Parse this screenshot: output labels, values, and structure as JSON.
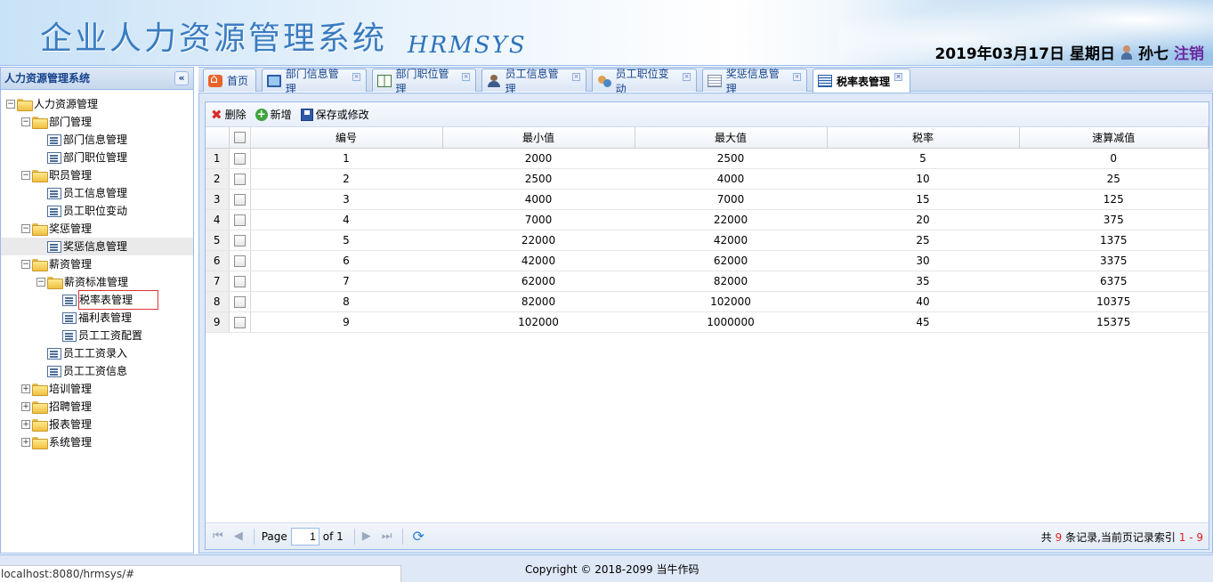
{
  "header": {
    "title": "企业人力资源管理系统",
    "subtitle": "HRMSYS",
    "date": "2019年03月17日 星期日",
    "user": "孙七",
    "logout": "注销"
  },
  "sidebar": {
    "title": "人力资源管理系统",
    "collapse": "«",
    "tree": [
      {
        "label": "人力资源管理",
        "type": "folder",
        "level": 0,
        "toggle": "⊟"
      },
      {
        "label": "部门管理",
        "type": "folder",
        "level": 1,
        "toggle": "⊟"
      },
      {
        "label": "部门信息管理",
        "type": "file",
        "level": 2
      },
      {
        "label": "部门职位管理",
        "type": "file",
        "level": 2
      },
      {
        "label": "职员管理",
        "type": "folder",
        "level": 1,
        "toggle": "⊟"
      },
      {
        "label": "员工信息管理",
        "type": "file",
        "level": 2
      },
      {
        "label": "员工职位变动",
        "type": "file",
        "level": 2
      },
      {
        "label": "奖惩管理",
        "type": "folder",
        "level": 1,
        "toggle": "⊟"
      },
      {
        "label": "奖惩信息管理",
        "type": "file",
        "level": 2
      },
      {
        "label": "薪资管理",
        "type": "folder",
        "level": 1,
        "toggle": "⊟"
      },
      {
        "label": "薪资标准管理",
        "type": "folder",
        "level": 2,
        "toggle": "⊟"
      },
      {
        "label": "税率表管理",
        "type": "file",
        "level": 3
      },
      {
        "label": "福利表管理",
        "type": "file",
        "level": 3
      },
      {
        "label": "员工工资配置",
        "type": "file",
        "level": 3
      },
      {
        "label": "员工工资录入",
        "type": "file",
        "level": 2
      },
      {
        "label": "员工工资信息",
        "type": "file",
        "level": 2
      },
      {
        "label": "培训管理",
        "type": "folder",
        "level": 1,
        "toggle": "⊞"
      },
      {
        "label": "招聘管理",
        "type": "folder",
        "level": 1,
        "toggle": "⊞"
      },
      {
        "label": "报表管理",
        "type": "folder",
        "level": 1,
        "toggle": "⊞"
      },
      {
        "label": "系统管理",
        "type": "folder",
        "level": 1,
        "toggle": "⊞"
      }
    ]
  },
  "tabs": [
    {
      "label": "首页",
      "icon": "home-icon",
      "closable": false
    },
    {
      "label": "部门信息管理",
      "icon": "monitor-icon",
      "closable": true
    },
    {
      "label": "部门职位管理",
      "icon": "grid-icon",
      "closable": true
    },
    {
      "label": "员工信息管理",
      "icon": "person-icon",
      "closable": true
    },
    {
      "label": "员工职位变动",
      "icon": "people-icon",
      "closable": true
    },
    {
      "label": "奖惩信息管理",
      "icon": "document-icon",
      "closable": true
    },
    {
      "label": "税率表管理",
      "icon": "table-icon",
      "closable": true,
      "active": true
    }
  ],
  "toolbar": {
    "delete": "删除",
    "add": "新增",
    "save": "保存或修改"
  },
  "grid": {
    "columns": [
      "编号",
      "最小值",
      "最大值",
      "税率",
      "速算减值"
    ],
    "rows": [
      [
        "1",
        "2000",
        "2500",
        "5",
        "0"
      ],
      [
        "2",
        "2500",
        "4000",
        "10",
        "25"
      ],
      [
        "3",
        "4000",
        "7000",
        "15",
        "125"
      ],
      [
        "4",
        "7000",
        "22000",
        "20",
        "375"
      ],
      [
        "5",
        "22000",
        "42000",
        "25",
        "1375"
      ],
      [
        "6",
        "42000",
        "62000",
        "30",
        "3375"
      ],
      [
        "7",
        "62000",
        "82000",
        "35",
        "6375"
      ],
      [
        "8",
        "82000",
        "102000",
        "40",
        "10375"
      ],
      [
        "9",
        "102000",
        "1000000",
        "45",
        "15375"
      ]
    ]
  },
  "pager": {
    "page_label": "Page",
    "page_value": "1",
    "of_label": "of 1",
    "info_prefix": "共",
    "info_count": "9",
    "info_middle": "条记录,当前页记录索引",
    "info_range": "1 - 9"
  },
  "footer": {
    "copyright": "Copyright © 2018-2099 当牛作码"
  },
  "status_url": "localhost:8080/hrmsys/#"
}
